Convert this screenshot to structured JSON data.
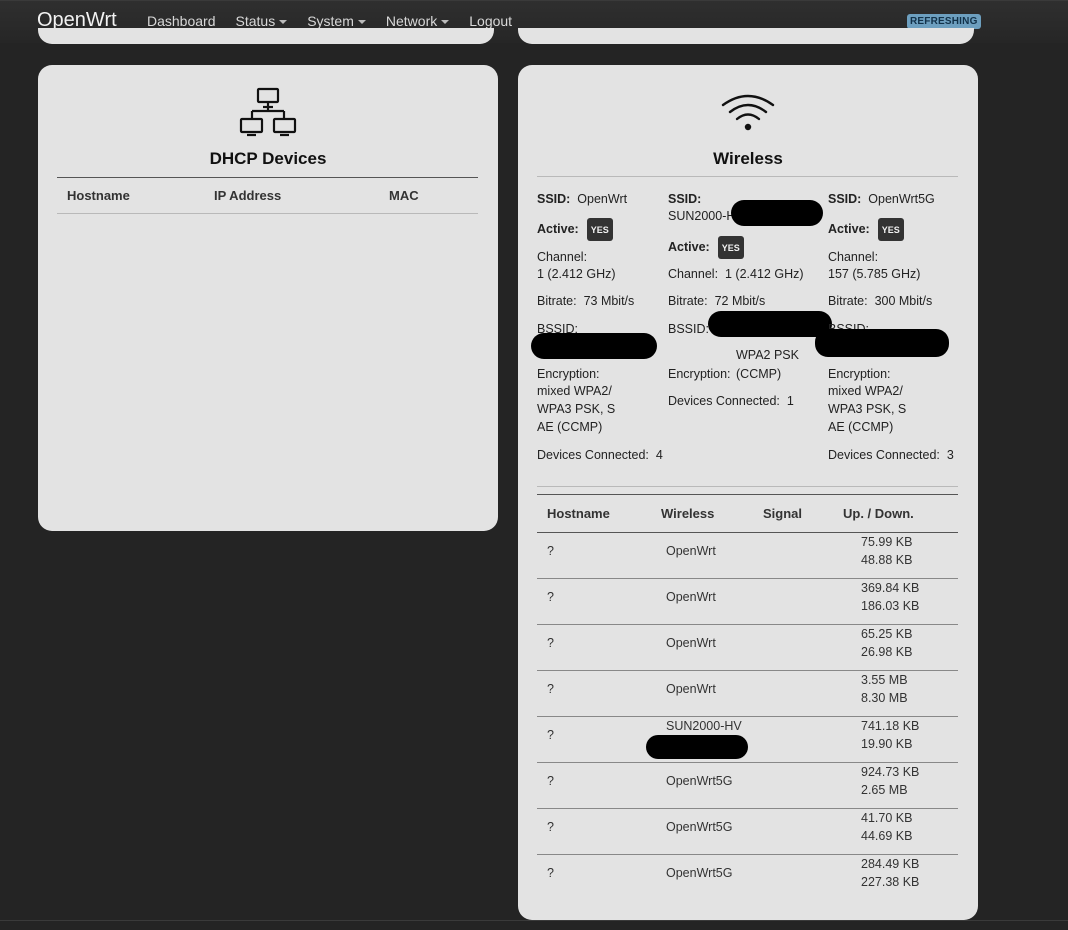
{
  "brand": "OpenWrt",
  "nav": {
    "dashboard": "Dashboard",
    "status": "Status",
    "system": "System",
    "network": "Network",
    "logout": "Logout",
    "refreshing": "REFRESHING"
  },
  "dhcp": {
    "title": "DHCP Devices",
    "columns": [
      "Hostname",
      "IP Address",
      "MAC"
    ]
  },
  "wireless": {
    "title": "Wireless",
    "labels": {
      "ssid": "SSID:",
      "active": "Active:",
      "channel": "Channel:",
      "bitrate": "Bitrate:",
      "bssid": "BSSID:",
      "encryption": "Encryption:",
      "devices": "Devices Connected:"
    },
    "yes": "YES",
    "networks": [
      {
        "ssid": "OpenWrt",
        "channel": "1 (2.412 GHz)",
        "bitrate": "73 Mbit/s",
        "encryption": [
          "mixed WPA2/",
          "WPA3 PSK, S",
          "AE (CCMP)"
        ],
        "devices": "4"
      },
      {
        "ssid": "SUN2000-H",
        "channel": "1 (2.412 GHz)",
        "bitrate": "72 Mbit/s",
        "encryption": [
          "WPA2 PSK",
          "(CCMP)"
        ],
        "devices": "1"
      },
      {
        "ssid": "OpenWrt5G",
        "channel": "157 (5.785 GHz)",
        "bitrate": "300 Mbit/s",
        "encryption": [
          "mixed WPA2/",
          "WPA3 PSK, S",
          "AE (CCMP)"
        ],
        "devices": "3"
      }
    ],
    "columns": [
      "Hostname",
      "Wireless",
      "Signal",
      "Up. / Down."
    ],
    "clients": [
      {
        "hostname": "?",
        "wireless": "OpenWrt",
        "up": "75.99 KB",
        "down": "48.88 KB"
      },
      {
        "hostname": "?",
        "wireless": "OpenWrt",
        "up": "369.84 KB",
        "down": "186.03 KB"
      },
      {
        "hostname": "?",
        "wireless": "OpenWrt",
        "up": "65.25 KB",
        "down": "26.98 KB"
      },
      {
        "hostname": "?",
        "wireless": "OpenWrt",
        "up": "3.55 MB",
        "down": "8.30 MB"
      },
      {
        "hostname": "?",
        "wireless": "SUN2000-HV",
        "up": "741.18 KB",
        "down": "19.90 KB"
      },
      {
        "hostname": "?",
        "wireless": "OpenWrt5G",
        "up": "924.73 KB",
        "down": "2.65 MB"
      },
      {
        "hostname": "?",
        "wireless": "OpenWrt5G",
        "up": "41.70 KB",
        "down": "44.69 KB"
      },
      {
        "hostname": "?",
        "wireless": "OpenWrt5G",
        "up": "284.49 KB",
        "down": "227.38 KB"
      }
    ]
  }
}
